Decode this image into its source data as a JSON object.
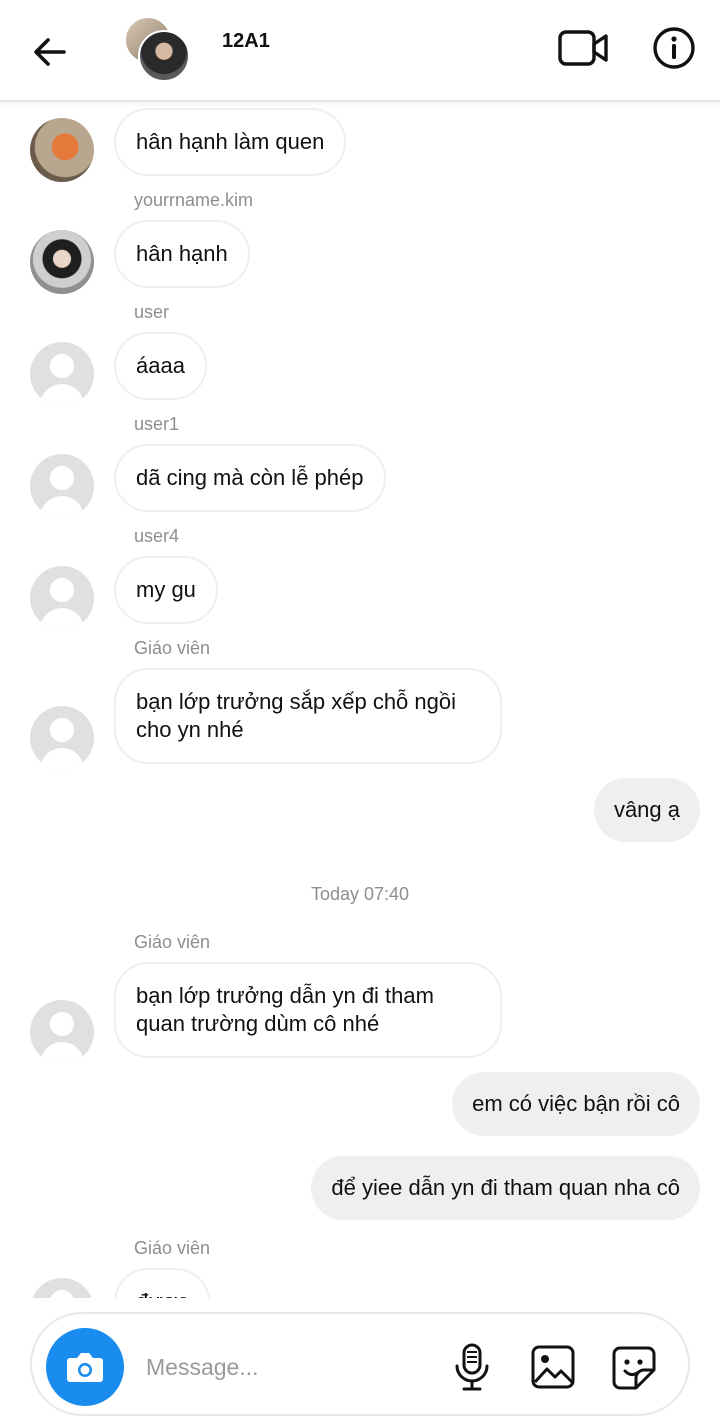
{
  "header": {
    "title": "12A1",
    "icons": {
      "back": "back-arrow-icon",
      "video": "video-call-icon",
      "info": "info-icon"
    }
  },
  "messages": [
    {
      "type": "in",
      "sender": "",
      "text": "hân hạnh làm quen",
      "avatar": "photo"
    },
    {
      "type": "in",
      "sender": "yourrname.kim",
      "text": "hân hạnh",
      "avatar": "photo"
    },
    {
      "type": "in",
      "sender": "user",
      "text": "áaaa",
      "avatar": "default"
    },
    {
      "type": "in",
      "sender": "user1",
      "text": "dã cing mà còn lễ phép",
      "avatar": "default"
    },
    {
      "type": "in",
      "sender": "user4",
      "text": "my gu",
      "avatar": "default"
    },
    {
      "type": "in",
      "sender": "Giáo viên",
      "text": "bạn lớp trưởng sắp xếp chỗ ngồi cho yn nhé",
      "avatar": "default"
    },
    {
      "type": "out",
      "text": "vâng ạ"
    },
    {
      "type": "timestamp",
      "text": "Today 07:40"
    },
    {
      "type": "in",
      "sender": "Giáo viên",
      "text": "bạn lớp trưởng dẫn yn đi tham quan trường dùm cô nhé",
      "avatar": "default"
    },
    {
      "type": "out",
      "text": "em có việc bận rồi cô"
    },
    {
      "type": "out",
      "text": "để yiee dẫn yn đi tham quan nha cô"
    },
    {
      "type": "in",
      "sender": "Giáo viên",
      "text": "được",
      "avatar": "default"
    }
  ],
  "composer": {
    "placeholder": "Message...",
    "icons": {
      "camera": "camera-icon",
      "mic": "microphone-icon",
      "gallery": "gallery-icon",
      "sticker": "sticker-icon"
    }
  },
  "colors": {
    "accent": "#1a8cf0",
    "outgoing_bubble": "#efefef",
    "meta_text": "#8e8e8e"
  }
}
